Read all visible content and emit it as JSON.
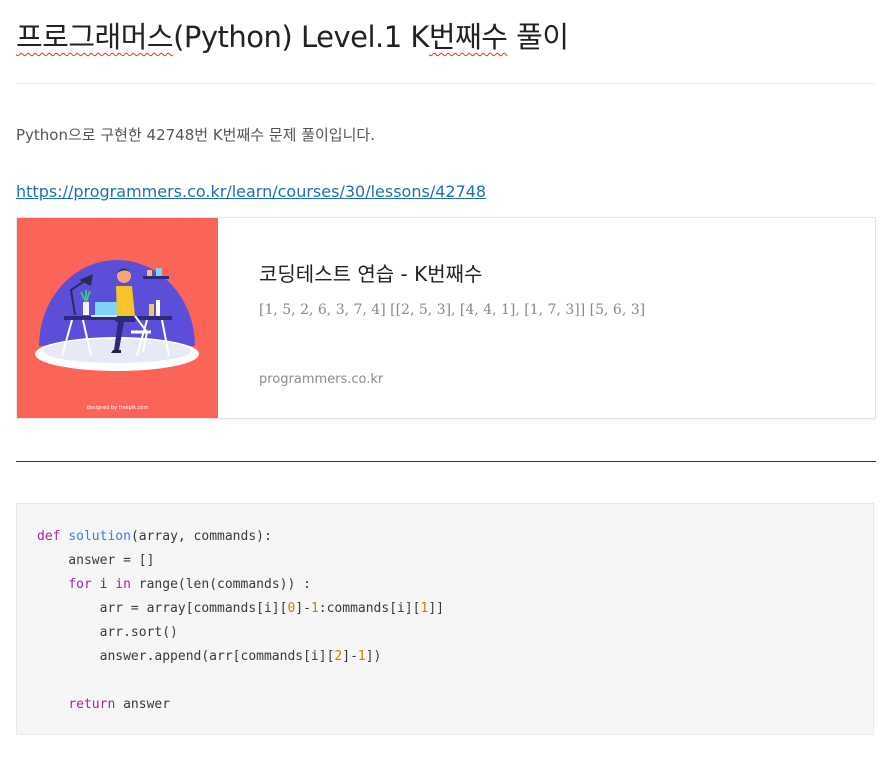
{
  "post": {
    "title_prefix": "프로그래머스",
    "title_middle": "(Python) Level.1 K",
    "title_spell": "번째수",
    "title_suffix": " 풀이",
    "intro": "Python으로 구현한 42748번 K번째수 문제 풀이입니다.",
    "link": "https://programmers.co.kr/learn/courses/30/lessons/42748"
  },
  "link_card": {
    "title": "코딩테스트 연습 - K번째수",
    "description": "[1, 5, 2, 6, 3, 7, 4] [[2, 5, 3], [4, 4, 1], [1, 7, 3]] [5, 6, 3]",
    "domain": "programmers.co.kr",
    "thumbnail_credit": "designed by freepik.com",
    "thumbnail_bg": "#fb6459"
  },
  "code": {
    "language": "python",
    "lines": [
      [
        {
          "t": "def",
          "c": "kw"
        },
        {
          "t": " "
        },
        {
          "t": "solution",
          "c": "fn"
        },
        {
          "t": "(array, commands):"
        }
      ],
      [
        {
          "t": "    answer = []"
        }
      ],
      [
        {
          "t": "    "
        },
        {
          "t": "for",
          "c": "kw"
        },
        {
          "t": " i "
        },
        {
          "t": "in",
          "c": "kw"
        },
        {
          "t": " range(len(commands)) :"
        }
      ],
      [
        {
          "t": "        arr = array[commands[i]["
        },
        {
          "t": "0",
          "c": "num"
        },
        {
          "t": "]-"
        },
        {
          "t": "1",
          "c": "num"
        },
        {
          "t": ":commands[i]["
        },
        {
          "t": "1",
          "c": "num"
        },
        {
          "t": "]]"
        }
      ],
      [
        {
          "t": "        arr.sort()"
        }
      ],
      [
        {
          "t": "        answer.append(arr[commands[i]["
        },
        {
          "t": "2",
          "c": "num"
        },
        {
          "t": "]-"
        },
        {
          "t": "1",
          "c": "num"
        },
        {
          "t": "])"
        }
      ],
      [
        {
          "t": ""
        }
      ],
      [
        {
          "t": "    "
        },
        {
          "t": "return",
          "c": "kw"
        },
        {
          "t": " answer"
        }
      ]
    ]
  }
}
